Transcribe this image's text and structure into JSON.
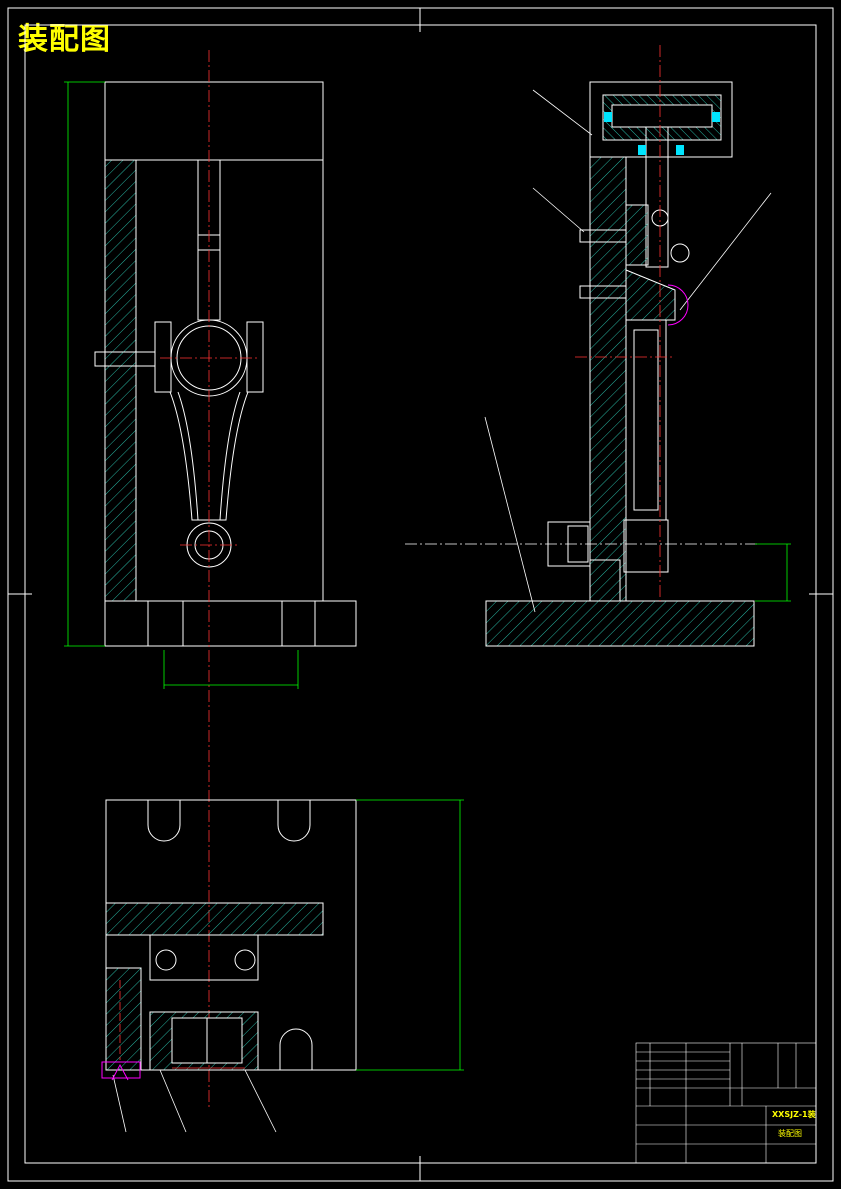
{
  "title": "装配图",
  "colors": {
    "outline": "#ffffff",
    "hatch": "#27b3a0",
    "dimension": "#00ff00",
    "center": "#ff3333",
    "highlight": "#ff00ff",
    "title_text": "#ffff00"
  },
  "title_block": {
    "drawing_no": "XXSJZ-1装",
    "drawing_name": "装配图"
  }
}
